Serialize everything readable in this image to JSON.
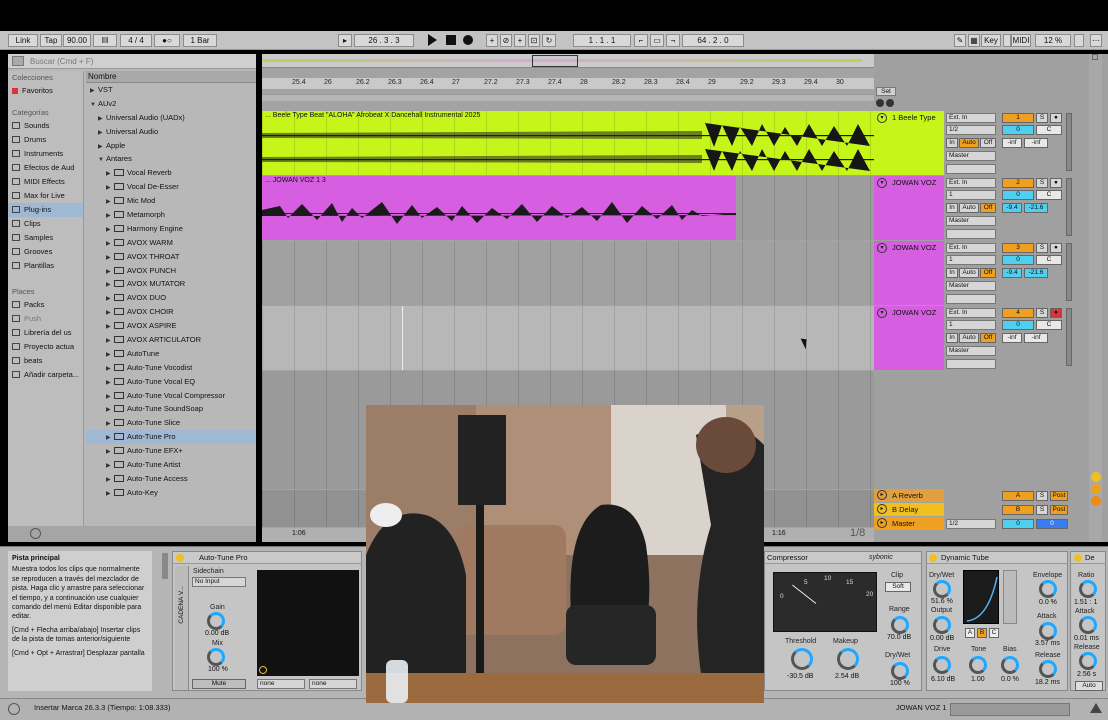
{
  "transport": {
    "link": "Link",
    "tap": "Tap",
    "tempo": "90.00",
    "signature": "4 / 4",
    "quantize": "1 Bar",
    "position": "26 .   3 .   3",
    "loop_start": "1 .   1 .   1",
    "loop_length": "64 .   2 .   0",
    "key": "Key",
    "midi": "MIDI",
    "cpu": "12 %",
    "icons": [
      "play-icon",
      "stop-icon",
      "record-icon",
      "metronome-icon",
      "draw-icon"
    ]
  },
  "browser": {
    "search_placeholder": "Buscar (Cmd + F)",
    "collections_header": "Colecciones",
    "favorites": "Favoritos",
    "categories_header": "Categorías",
    "categories": [
      "Sounds",
      "Drums",
      "Instruments",
      "Efectos de Aud",
      "MIDI Effects",
      "Max for Live",
      "Plug-ins",
      "Clips",
      "Samples",
      "Grooves",
      "Plantillas"
    ],
    "selected_category": "Plug-ins",
    "places_header": "Places",
    "places": [
      "Packs",
      "Push",
      "Librería del us",
      "Proyecto actua",
      "beats",
      "Añadir carpeta..."
    ],
    "name_header": "Nombre",
    "folders": [
      "VST",
      "AUv2",
      "Universal Audio (UADx)",
      "Universal Audio",
      "Apple",
      "Antares"
    ],
    "plugins": [
      "Vocal Reverb",
      "Vocal De-Esser",
      "Mic Mod",
      "Metamorph",
      "Harmony Engine",
      "AVOX WARM",
      "AVOX THROAT",
      "AVOX PUNCH",
      "AVOX MUTATOR",
      "AVOX DUO",
      "AVOX CHOIR",
      "AVOX ASPIRE",
      "AVOX ARTICULATOR",
      "AutoTune",
      "Auto-Tune Vocodist",
      "Auto-Tune Vocal EQ",
      "Auto-Tune Vocal Compressor",
      "Auto-Tune SoundSoap",
      "Auto-Tune Slice",
      "Auto-Tune Pro",
      "Auto-Tune EFX+",
      "Auto-Tune Artist",
      "Auto-Tune Access",
      "Auto-Key"
    ],
    "selected_plugin": "Auto-Tune Pro"
  },
  "ruler": {
    "ticks": [
      "25.4",
      "26",
      "26.2",
      "26.3",
      "26.4",
      "27",
      "27.2",
      "27.3",
      "27.4",
      "28",
      "28.2",
      "28.3",
      "28.4",
      "29",
      "29.2",
      "29.3",
      "29.4",
      "30"
    ],
    "set_label": "Set",
    "time_left": "1:06",
    "time_right": "1:16",
    "zoom": "1/8"
  },
  "clips": [
    {
      "title": "... Beele Type Beat \"ALOHA\" Afrobeat X Dancehall Instrumental 2025",
      "color": "#c6f51a"
    },
    {
      "title": "... JOWAN VOZ 1 3",
      "color": "#d65ee0"
    }
  ],
  "tracks": [
    {
      "name": "1 Beele Type",
      "number": "1",
      "input": "Ext. In",
      "channel": "1/2",
      "monitor": "Auto",
      "volume": "-inf",
      "pan": "-inf",
      "output": "Master",
      "color": "#c6f51a",
      "armed": false
    },
    {
      "name": "JOWAN VOZ",
      "number": "2",
      "input": "Ext. In",
      "channel": "1",
      "monitor": "Off",
      "volume": "-9.4",
      "pan": "-21.6",
      "output": "Master",
      "color": "#d65ee0",
      "armed": false
    },
    {
      "name": "JOWAN VOZ",
      "number": "3",
      "input": "Ext. In",
      "channel": "1",
      "monitor": "Off",
      "volume": "-9.4",
      "pan": "-21.6",
      "output": "Master",
      "color": "#d65ee0",
      "armed": false
    },
    {
      "name": "JOWAN VOZ",
      "number": "4",
      "input": "Ext. In",
      "channel": "1",
      "monitor": "Off",
      "volume": "-inf",
      "pan": "-inf",
      "output": "Master",
      "color": "#d65ee0",
      "armed": true
    }
  ],
  "returns": [
    {
      "name": "A Reverb",
      "letter": "A",
      "color": "#e0a040"
    },
    {
      "name": "B Delay",
      "letter": "B",
      "color": "#f0c020"
    },
    {
      "name": "Master",
      "letter": "",
      "color": "#f0a020",
      "channel": "1/2",
      "value": "0"
    }
  ],
  "track_button_labels": {
    "solo": "S",
    "in": "In",
    "auto": "Auto",
    "off": "Off",
    "c": "C",
    "post": "Post",
    "zero": "0"
  },
  "info": {
    "title": "Pista principal",
    "body": "Muestra todos los clips que normalmente se reproducen a través del mezclador de pista. Haga clic y arrastre para seleccionar el tiempo, y a continuación use cualquier comando del menú Editar disponible para editar.",
    "hint1": "[Cmd + Flecha arriba/abajo] Insertar clips de la pista de tomas anterior/siguiente",
    "hint2": "[Cmd + Opt + Arrastrar] Desplazar pantalla"
  },
  "devices": {
    "chain_label": "CADENA V...",
    "autotune": {
      "title": "Auto-Tune Pro",
      "sidechain": "Sidechain",
      "no_input": "No Input",
      "gain_label": "Gain",
      "gain": "0.00 dB",
      "mix_label": "Mix",
      "mix": "100 %",
      "mute": "Mute",
      "none1": "none",
      "none2": "none"
    },
    "compressor": {
      "title": "Compressor",
      "brand": "sybonic",
      "scale": [
        "0",
        "5",
        "10",
        "15",
        "20"
      ],
      "clip": "Clip",
      "soft": "Soft",
      "threshold_label": "Threshold",
      "threshold": "-30.5 dB",
      "makeup_label": "Makeup",
      "makeup": "2.54 dB",
      "range_label": "Range",
      "range": "70.0 dB",
      "drywet_label": "Dry/Wet",
      "drywet": "100 %"
    },
    "dynamic_tube": {
      "title": "Dynamic Tube",
      "drywet_label": "Dry/Wet",
      "drywet": "51.6 %",
      "output_label": "Output",
      "output": "0.00 dB",
      "envelope_label": "Envelope",
      "envelope": "0.0 %",
      "attack_label": "Attack",
      "attack": "3.57 ms",
      "release_label": "Release",
      "release": "18.2 ms",
      "drive_label": "Drive",
      "drive": "6.10 dB",
      "tone_label": "Tone",
      "tone": "1.00",
      "bias_label": "Bias",
      "bias": "0.0 %",
      "abc": [
        "A",
        "B",
        "C"
      ]
    },
    "partial": {
      "title": "De",
      "ratio_label": "Ratio",
      "ratio": "1.51 : 1",
      "attack_label": "Attack",
      "attack": "0.01 ms",
      "release_label": "Release",
      "release": "2.56 s",
      "auto": "Auto"
    }
  },
  "status": {
    "text": "Insertar Marca 26.3.3 (Tiempo: 1:08.333)",
    "track_label": "JOWAN VOZ 1"
  }
}
